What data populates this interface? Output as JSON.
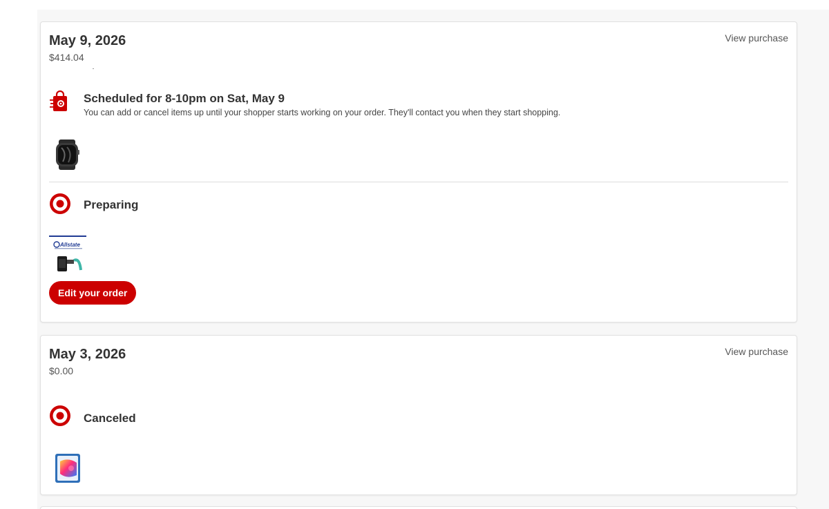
{
  "orders": [
    {
      "date": "May 9, 2026",
      "total": "$414.04",
      "view_label": "View purchase",
      "schedule": {
        "icon": "shopping-bag-icon",
        "title": "Scheduled for 8-10pm on Sat, May 9",
        "description": "You can add or cancel items up until your shopper starts working on your order. They'll contact you when they start shopping."
      },
      "fulfillment": {
        "icon": "target-bullseye-icon",
        "status": "Preparing"
      },
      "protection_logo_text": "Allstate",
      "edit_label": "Edit your order"
    },
    {
      "date": "May 3, 2026",
      "total": "$0.00",
      "view_label": "View purchase",
      "fulfillment": {
        "icon": "target-bullseye-icon",
        "status": "Canceled"
      }
    }
  ],
  "colors": {
    "brand_red": "#cc0000",
    "page_bg": "#f7f7f7",
    "text": "#333333"
  }
}
